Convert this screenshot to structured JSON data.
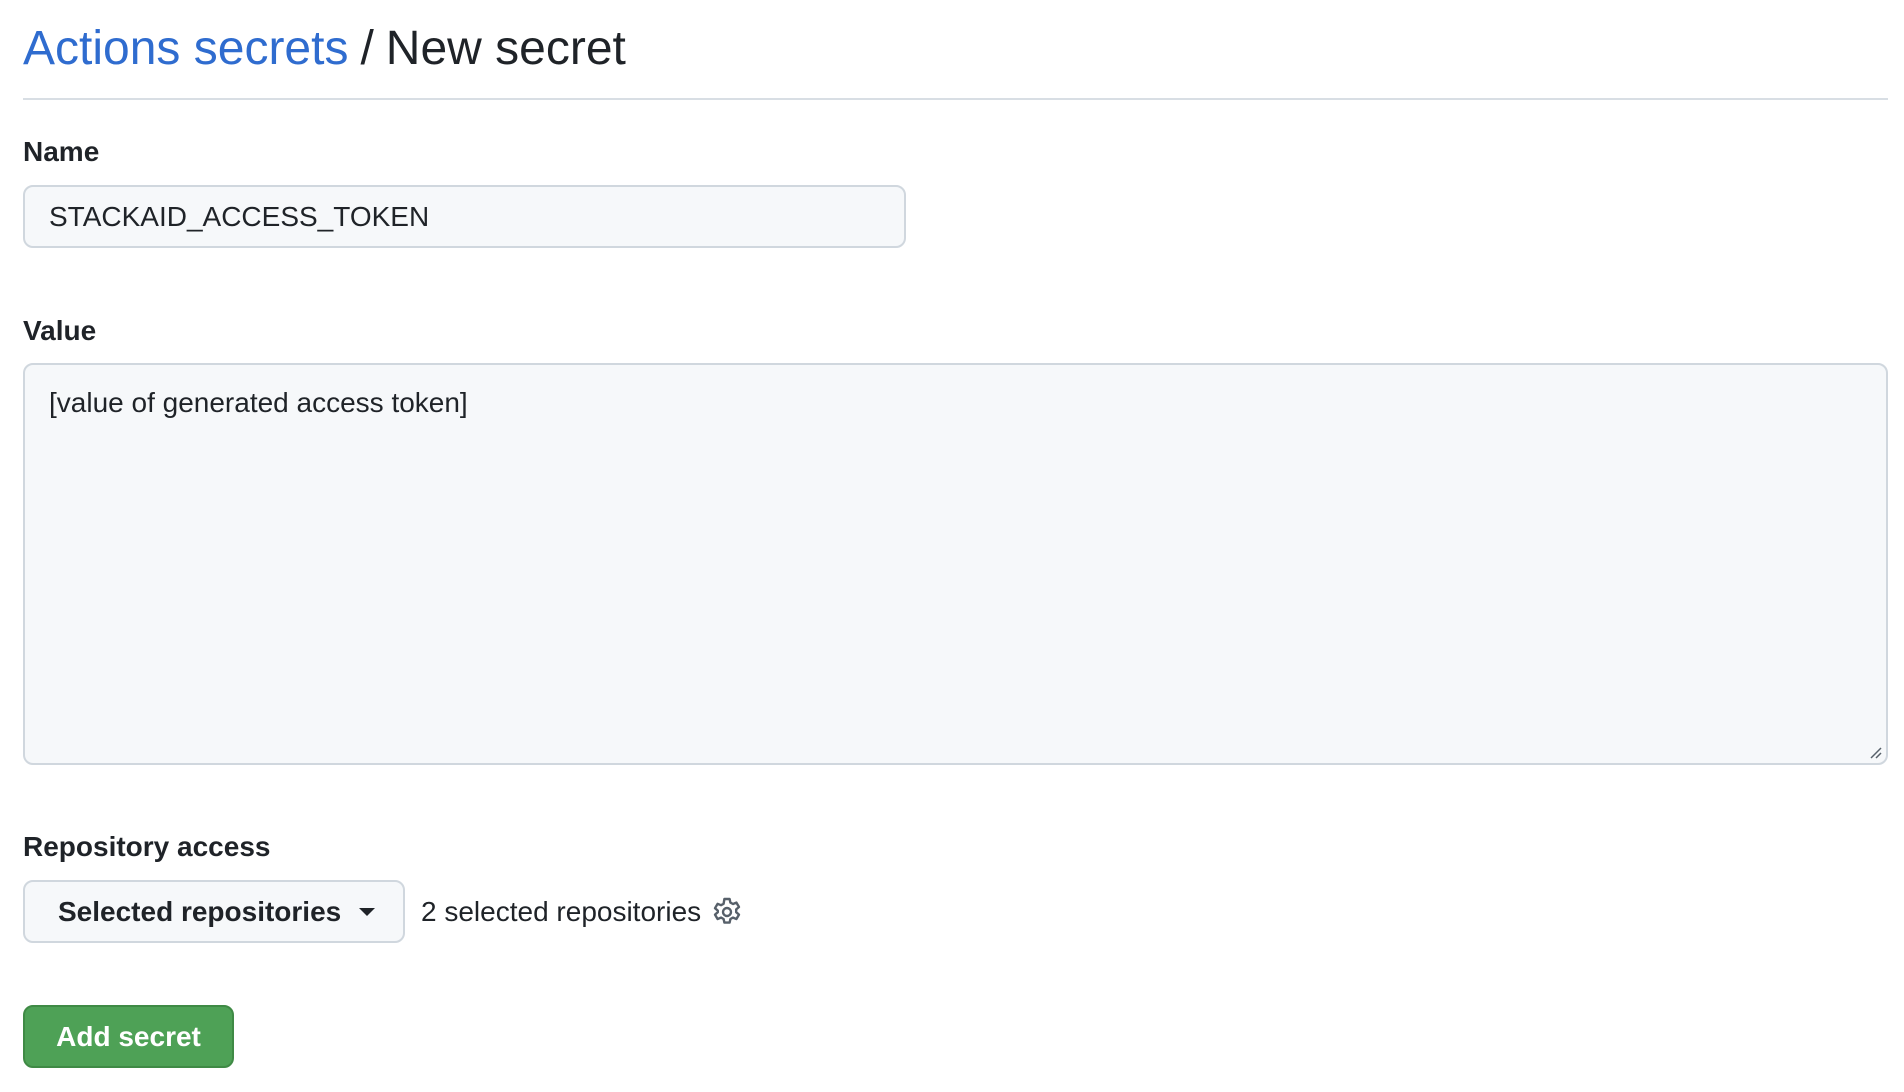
{
  "breadcrumb": {
    "parent": "Actions secrets",
    "separator": "/",
    "current": "New secret"
  },
  "form": {
    "name_label": "Name",
    "name_value": "STACKAID_ACCESS_TOKEN",
    "value_label": "Value",
    "value_text": "[value of generated access token]",
    "repo_access_label": "Repository access",
    "repo_access_selected": "Selected repositories",
    "repo_count_text": "2 selected repositories",
    "submit_label": "Add secret"
  },
  "icons": {
    "repo_settings": "gear-icon",
    "dropdown": "caret-down-icon",
    "textarea_resize": "resize-handle-icon"
  },
  "colors": {
    "link": "#2f6ccf",
    "primary_button": "#4ea156",
    "input_background": "#f6f8fa",
    "border": "#d0d7de"
  }
}
